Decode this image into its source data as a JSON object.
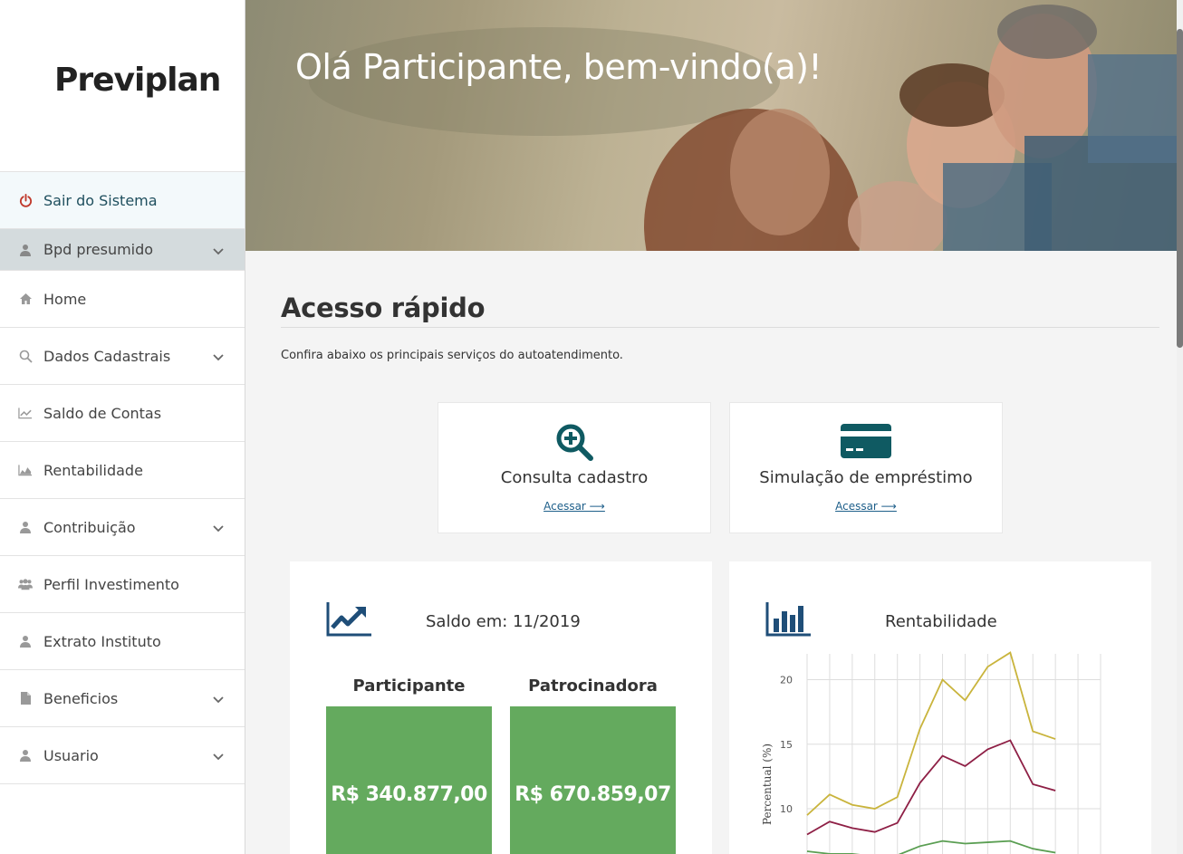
{
  "brand": {
    "logo_text": "Previplan"
  },
  "sidebar": {
    "items": [
      {
        "label": "Sair do Sistema",
        "icon": "power-icon"
      },
      {
        "label": "Bpd presumido",
        "icon": "user-icon",
        "expandable": true
      },
      {
        "label": "Home",
        "icon": "home-icon"
      },
      {
        "label": "Dados Cadastrais",
        "icon": "search-icon",
        "expandable": true
      },
      {
        "label": "Saldo de Contas",
        "icon": "line-chart-icon"
      },
      {
        "label": "Rentabilidade",
        "icon": "area-chart-icon"
      },
      {
        "label": "Contribuição",
        "icon": "user-icon",
        "expandable": true
      },
      {
        "label": "Perfil Investimento",
        "icon": "users-icon"
      },
      {
        "label": "Extrato Instituto",
        "icon": "user-icon"
      },
      {
        "label": "Beneficios",
        "icon": "file-icon",
        "expandable": true
      },
      {
        "label": "Usuario",
        "icon": "user-icon",
        "expandable": true
      }
    ]
  },
  "hero": {
    "title": "Olá Participante, bem-vindo(a)!"
  },
  "quick_access": {
    "title": "Acesso rápido",
    "subtitle": "Confira abaixo os principais serviços do autoatendimento.",
    "cards": [
      {
        "title": "Consulta cadastro",
        "link": "Acessar ⟶",
        "icon": "zoom-in-icon"
      },
      {
        "title": "Simulação de empréstimo",
        "link": "Acessar ⟶",
        "icon": "credit-card-icon"
      }
    ]
  },
  "balance": {
    "title": "Saldo em: 11/2019",
    "participant_label": "Participante",
    "participant_value": "R$ 340.877,00",
    "sponsor_label": "Patrocinadora",
    "sponsor_value": "R$ 670.859,07"
  },
  "colors": {
    "accent": "#0f5a62",
    "money_green": "#64aa5e"
  },
  "chart_data": {
    "type": "line",
    "title": "Rentabilidade",
    "ylabel": "Percentual (%)",
    "yticks": [
      "10",
      "15",
      "20"
    ],
    "ylim": [
      6,
      22
    ],
    "x": [
      1,
      2,
      3,
      4,
      5,
      6,
      7,
      8,
      9,
      10,
      11,
      12,
      13,
      14
    ],
    "series": [
      {
        "color": "#c9b43c",
        "values": [
          9.5,
          11.1,
          10.3,
          10.0,
          10.9,
          16.2,
          20.0,
          18.4,
          21.0,
          22.1,
          16.0,
          15.4
        ]
      },
      {
        "color": "#8e1f45",
        "values": [
          8.0,
          9.0,
          8.5,
          8.2,
          8.9,
          12.0,
          14.1,
          13.3,
          14.6,
          15.3,
          11.9,
          11.4
        ]
      },
      {
        "color": "#5a9e52",
        "values": [
          6.7,
          6.5,
          6.5,
          6.3,
          6.4,
          7.1,
          7.5,
          7.3,
          7.4,
          7.5,
          6.9,
          6.6
        ]
      }
    ]
  }
}
